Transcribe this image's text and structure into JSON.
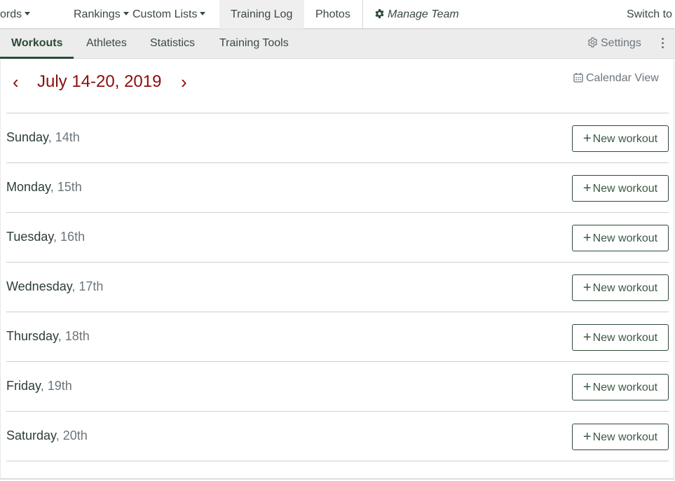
{
  "topnav": {
    "items": [
      {
        "label": "ords",
        "dropdown": true
      },
      {
        "label": "Rankings",
        "dropdown": true
      },
      {
        "label": "Custom Lists",
        "dropdown": true
      },
      {
        "label": "Training Log",
        "dropdown": false,
        "active": true
      },
      {
        "label": "Photos",
        "dropdown": false
      }
    ],
    "manage_team": {
      "icon": "gear-icon",
      "label": "Manage Team"
    },
    "switch_to": "Switch to"
  },
  "subnav": {
    "tabs": [
      {
        "label": "Workouts",
        "active": true
      },
      {
        "label": "Athletes"
      },
      {
        "label": "Statistics"
      },
      {
        "label": "Training Tools"
      }
    ],
    "settings": {
      "icon": "gear-outline-icon",
      "label": "Settings"
    },
    "more_icon": "vertical-ellipsis-icon"
  },
  "week": {
    "prev_icon": "chevron-left-icon",
    "title": "July 14-20, 2019",
    "next_icon": "chevron-right-icon",
    "calendar_view": {
      "icon": "calendar-icon",
      "label": "Calendar View"
    }
  },
  "days": [
    {
      "name": "Sunday",
      "num": ", 14th",
      "button": "New workout"
    },
    {
      "name": "Monday",
      "num": ", 15th",
      "button": "New workout"
    },
    {
      "name": "Tuesday",
      "num": ", 16th",
      "button": "New workout"
    },
    {
      "name": "Wednesday",
      "num": ", 17th",
      "button": "New workout"
    },
    {
      "name": "Thursday",
      "num": ", 18th",
      "button": "New workout"
    },
    {
      "name": "Friday",
      "num": ", 19th",
      "button": "New workout"
    },
    {
      "name": "Saturday",
      "num": ", 20th",
      "button": "New workout"
    }
  ],
  "colors": {
    "accent": "#8b0d0d",
    "primary": "#2d4a37",
    "muted": "#6c757d"
  }
}
